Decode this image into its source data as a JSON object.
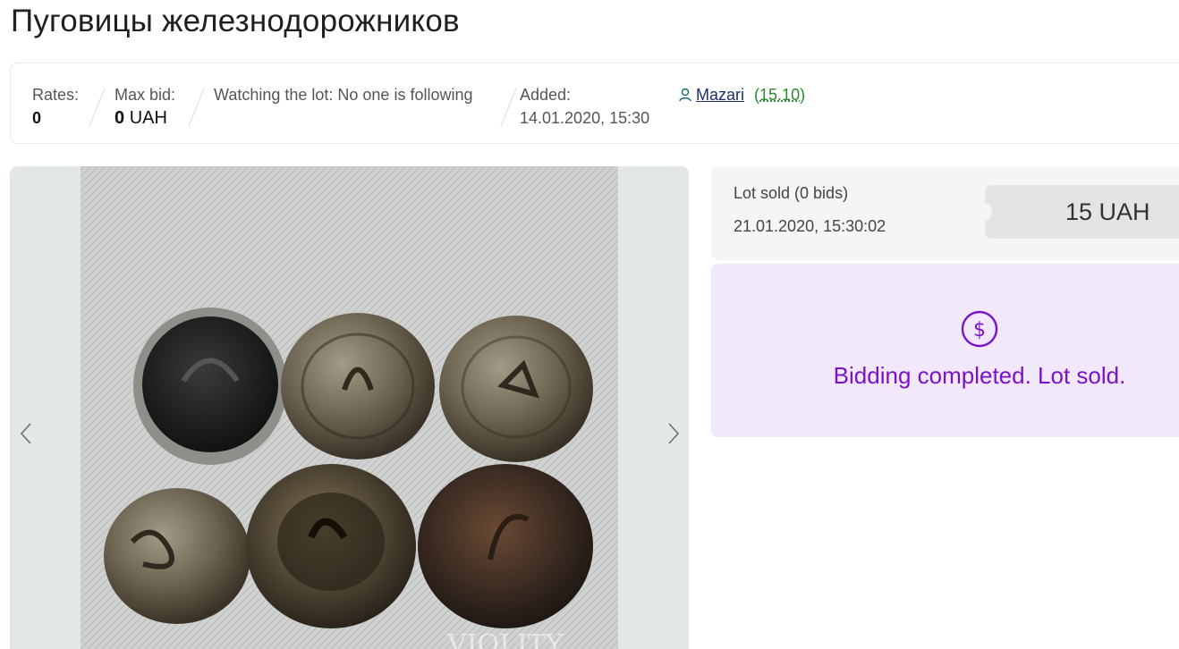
{
  "page": {
    "title": "Пуговицы железнодорожников"
  },
  "info": {
    "rates_label": "Rates:",
    "rates_value": "0",
    "max_bid_label": "Max bid:",
    "max_bid_value": "0",
    "max_bid_currency": "UAH",
    "watching_text": "Watching the lot: No one is following",
    "added_label": "Added:",
    "added_value": "14.01.2020, 15:30",
    "seller_name": "Mazari",
    "seller_rating_open": "(",
    "seller_rating": "15.10",
    "seller_rating_close": ")"
  },
  "gallery": {
    "prev_icon": "chevron-left-icon",
    "next_icon": "chevron-right-icon",
    "watermark": "VIOLITY"
  },
  "status": {
    "sold_text": "Lot sold (0 bids)",
    "sold_date": "21.01.2020, 15:30:02",
    "price": "15 UAH"
  },
  "completion": {
    "icon": "dollar-circle-icon",
    "message": "Bidding completed. Lot sold."
  },
  "colors": {
    "accent_purple": "#7b12c9",
    "completion_bg": "#f2e8fb",
    "rating_green": "#2b8a2b",
    "link_blue": "#1d2f6b"
  }
}
